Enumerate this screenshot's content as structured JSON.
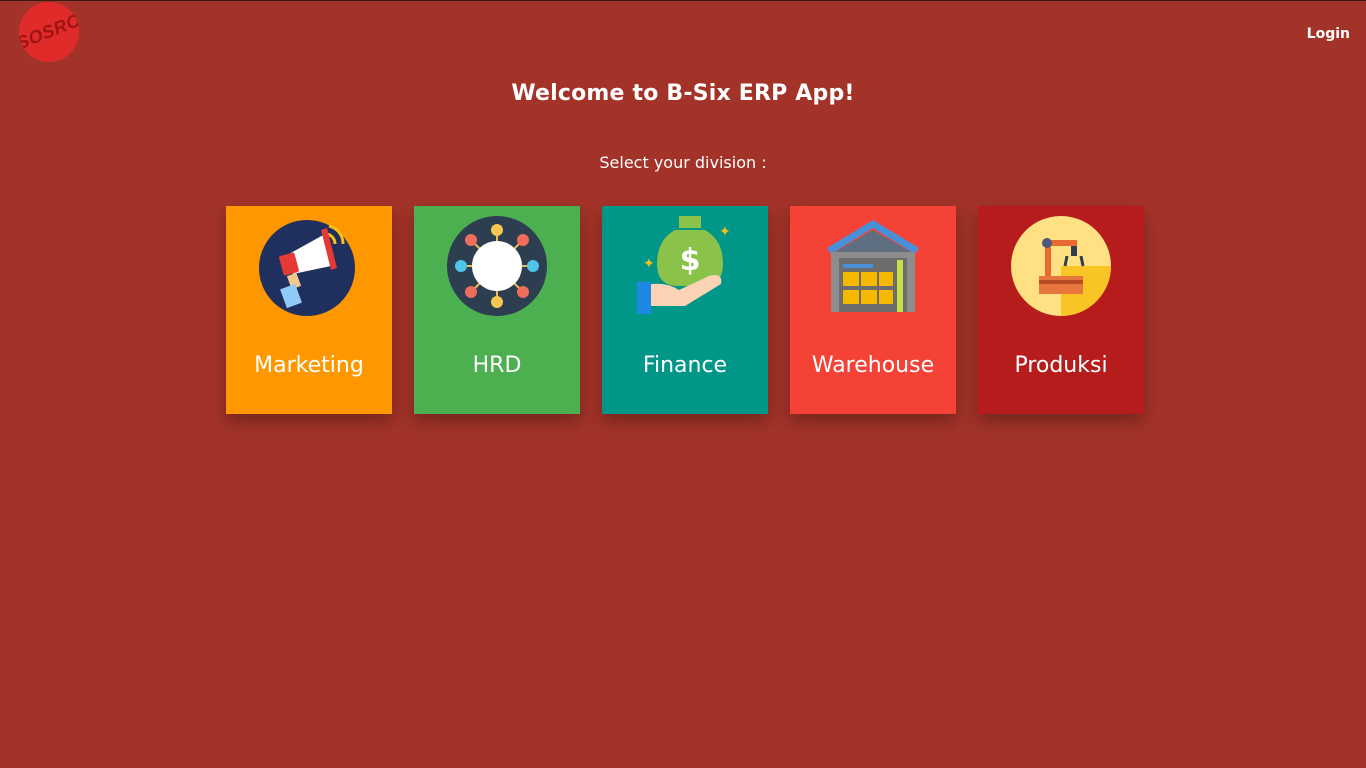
{
  "header": {
    "logo_text": "SOSRO",
    "login_label": "Login"
  },
  "main": {
    "title": "Welcome to B-Six ERP App!",
    "subtitle": "Select your division :"
  },
  "divisions": [
    {
      "label": "Marketing",
      "color": "#ff9800",
      "icon": "megaphone-icon"
    },
    {
      "label": "HRD",
      "color": "#4caf50",
      "icon": "team-network-icon"
    },
    {
      "label": "Finance",
      "color": "#009688",
      "icon": "money-bag-hand-icon"
    },
    {
      "label": "Warehouse",
      "color": "#f44336",
      "icon": "warehouse-icon"
    },
    {
      "label": "Produksi",
      "color": "#b71c1c",
      "icon": "robotic-arm-icon"
    }
  ],
  "colors": {
    "background": "#a33328",
    "logo": "#e12a2a"
  }
}
